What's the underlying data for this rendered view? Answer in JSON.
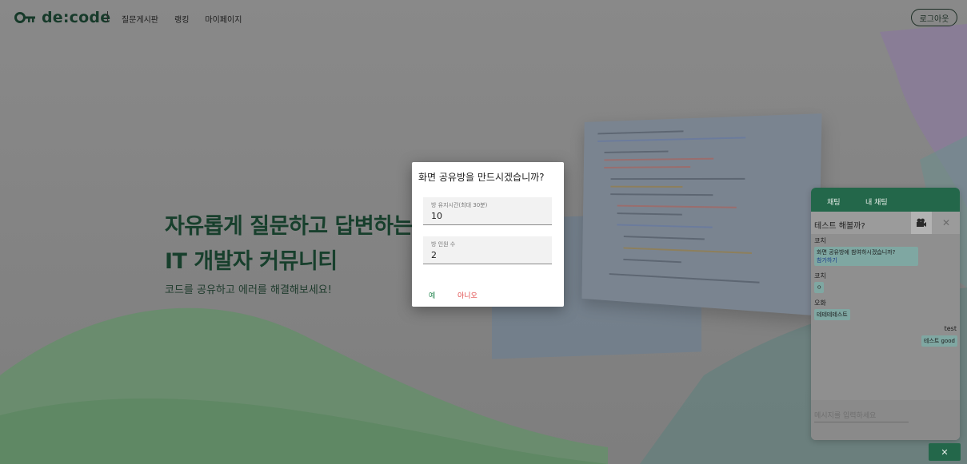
{
  "header": {
    "logo_text": "de:code",
    "nav": [
      "질문게시판",
      "랭킹",
      "마이페이지"
    ],
    "logout_label": "로그아웃"
  },
  "hero": {
    "title_line1": "자유롭게 질문하고 답변하는",
    "title_line2": "IT 개발자 커뮤니티",
    "subtitle": "코드를 공유하고 에러를 해결해보세요!"
  },
  "modal": {
    "title": "화면 공유방을 만드시겠습니까?",
    "field1_label": "방 유지시간(최대 30분)",
    "field1_value": "10",
    "field2_label": "방 인원 수",
    "field2_value": "2",
    "yes_label": "예",
    "no_label": "아니오"
  },
  "chat": {
    "tabs": [
      "채팅",
      "내 채팅"
    ],
    "room_title": "테스트 해볼까?",
    "messages": [
      {
        "name": "코치",
        "text": "화면 공유방에 참여하시겠습니까?",
        "link": "참가하기"
      },
      {
        "name": "코치",
        "text": "ㅇ"
      },
      {
        "name": "오화",
        "text": "테테테테스트"
      },
      {
        "name": "test",
        "text": "테스트 good"
      }
    ],
    "input_placeholder": "메시지를 입력하세요",
    "toggle_label": "✕"
  },
  "colors": {
    "brand_green": "#23674a",
    "yes": "#2e8b57",
    "no": "#e04a4a"
  }
}
